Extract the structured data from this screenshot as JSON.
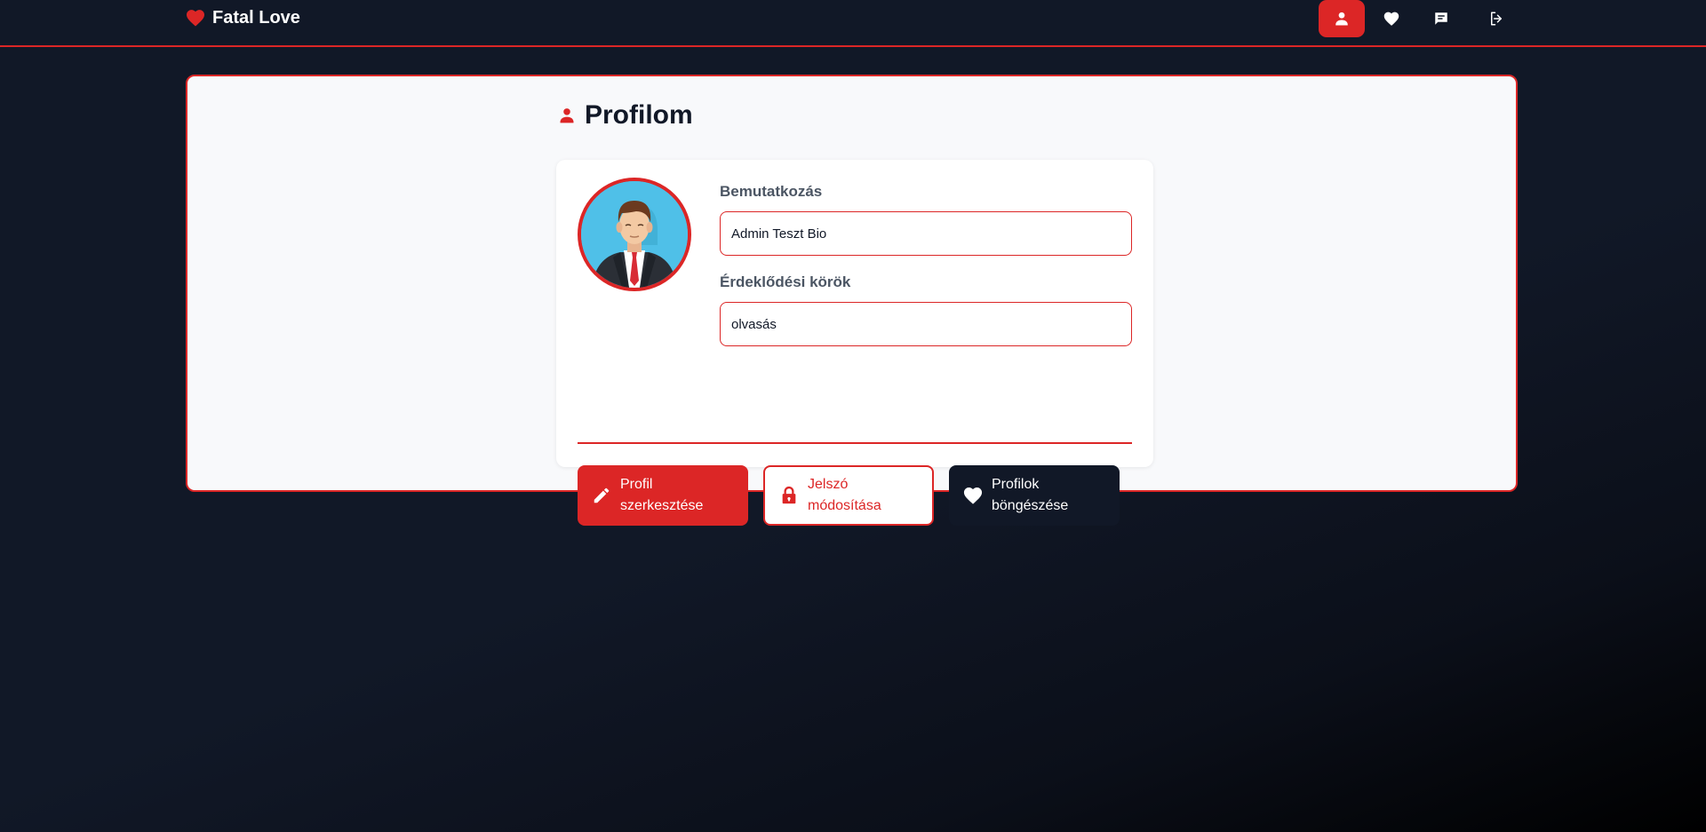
{
  "brand": {
    "name": "Fatal Love",
    "icon": "heart-icon"
  },
  "nav": {
    "items": [
      {
        "icon": "person-icon",
        "active": true
      },
      {
        "icon": "heart-icon",
        "active": false
      },
      {
        "icon": "chat-icon",
        "active": false
      },
      {
        "icon": "logout-icon",
        "active": false
      }
    ]
  },
  "page": {
    "title": "Profilom",
    "title_icon": "person-icon"
  },
  "profile": {
    "avatar": "avatar-man-in-suit",
    "bio_label": "Bemutatkozás",
    "bio_value": "Admin Teszt Bio",
    "interests_label": "Érdeklődési körök",
    "interests_value": "olvasás"
  },
  "actions": {
    "edit_label": "Profil\nszerkesztése",
    "password_label": "Jelszó\nmódosítása",
    "browse_label": "Profilok\nböngészése"
  },
  "colors": {
    "accent": "#dc2626",
    "dark": "#111827",
    "card_bg": "#f8f9fb"
  }
}
